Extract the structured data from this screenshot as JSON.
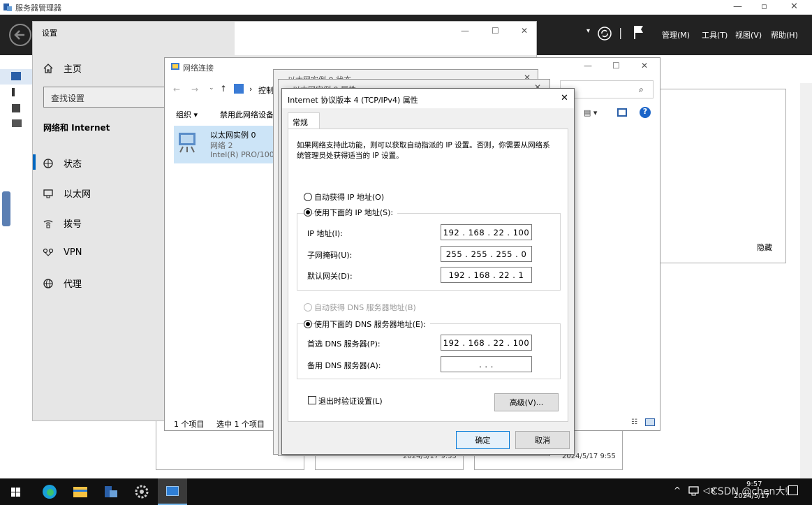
{
  "server_manager": {
    "title": "服务器管理器",
    "menus": [
      "管理(M)",
      "工具(T)",
      "视图(V)",
      "帮助(H)"
    ],
    "hide_label": "隐藏",
    "bpa_dates": [
      "2024/5/17 9:55",
      "2024/5/17 9:55",
      "2024/5/17 9:55"
    ]
  },
  "settings": {
    "title": "设置",
    "home": "主页",
    "search_placeholder": "查找设置",
    "section_title": "网络和 Internet",
    "nav": [
      {
        "label": "状态",
        "icon": "globe-status-icon"
      },
      {
        "label": "以太网",
        "icon": "ethernet-icon"
      },
      {
        "label": "拨号",
        "icon": "dialup-icon"
      },
      {
        "label": "VPN",
        "icon": "vpn-icon"
      },
      {
        "label": "代理",
        "icon": "proxy-icon"
      }
    ]
  },
  "network_connections": {
    "title": "网络连接",
    "address": "控制",
    "toolbar": {
      "organize": "组织 ▾",
      "disable": "禁用此网络设备"
    },
    "adapter": {
      "name": "以太网实例 0",
      "network": "网络 2",
      "device": "Intel(R) PRO/1000"
    },
    "status_left": "1 个项目",
    "status_right": "选中 1 个项目"
  },
  "bg_windows": {
    "status_title": "以太网实例 0 状态",
    "props_title": "以太网实例 0 属性"
  },
  "dialog": {
    "title": "Internet 协议版本 4 (TCP/IPv4) 属性",
    "tab": "常规",
    "description": "如果网络支持此功能，则可以获取自动指派的 IP 设置。否则，你需要从网络系统管理员处获得适当的 IP 设置。",
    "auto_ip": "自动获得 IP 地址(O)",
    "manual_ip": "使用下面的 IP 地址(S):",
    "ip_label": "IP 地址(I):",
    "ip_value": "192 . 168 .  22  . 100",
    "mask_label": "子网掩码(U):",
    "mask_value": "255 . 255 . 255 .  0",
    "gateway_label": "默认网关(D):",
    "gateway_value": "192 . 168 .  22  .  1",
    "auto_dns": "自动获得 DNS 服务器地址(B)",
    "manual_dns": "使用下面的 DNS 服务器地址(E):",
    "dns1_label": "首选 DNS 服务器(P):",
    "dns1_value": "192 . 168 .  22  . 100",
    "dns2_label": "备用 DNS 服务器(A):",
    "dns2_value": ".       .       .",
    "validate": "退出时验证设置(L)",
    "advanced": "高级(V)...",
    "ok": "确定",
    "cancel": "取消"
  },
  "taskbar": {
    "time": "9:57",
    "date": "2024/5/17",
    "watermark": "CSDN @chen大帅"
  }
}
